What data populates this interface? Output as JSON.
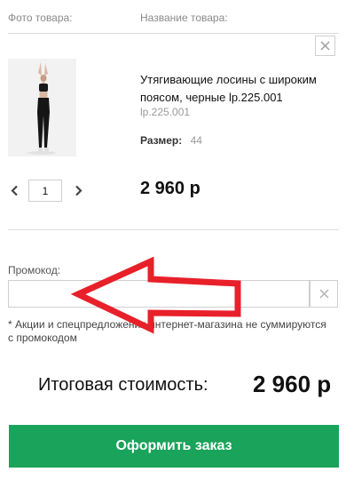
{
  "headers": {
    "photo": "Фото товара:",
    "name": "Название товара:"
  },
  "product": {
    "name": "Утягивающие лосины с широким поясом, черные lp.225.001",
    "sku": "lp.225.001",
    "size_label": "Размер:",
    "size_value": "44",
    "quantity": "1",
    "price": "2 960 р"
  },
  "promo": {
    "label": "Промокод:",
    "value": "",
    "note": "* Акции и спецпредложения интернет-магазина не суммируются с промокодом"
  },
  "total": {
    "label": "Итоговая стоимость:",
    "value": "2 960 р"
  },
  "order_button": {
    "label": "Оформить заказ"
  },
  "colors": {
    "accent": "#1aa35a",
    "annotation_arrow": "#e8202a"
  },
  "icons": [
    "close-icon",
    "chevron-left-icon",
    "chevron-right-icon",
    "clear-icon",
    "annotation-arrow"
  ]
}
